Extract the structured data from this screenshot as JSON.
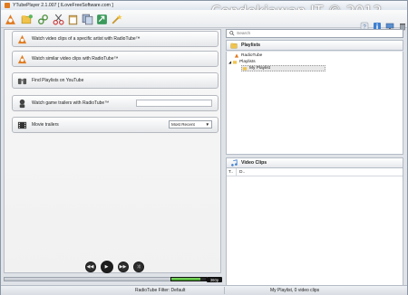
{
  "window": {
    "title": "YTubePlayer 2.1.007 [ ILoveFreeSoftware.com ]",
    "watermark": "Cendekiawan IT © 2012"
  },
  "toolbar": {
    "buttons": [
      "radiotube-icon",
      "folder-add-icon",
      "link-icon",
      "scissors-icon",
      "clipboard-icon",
      "copy-icon",
      "share-icon",
      "wand-icon"
    ],
    "right_icons": [
      "help-icon",
      "info-icon",
      "display-icon",
      "trash-icon"
    ]
  },
  "actions": {
    "artist_label": "Watch video clips of a specific artist with RadioTube™",
    "similar_label": "Watch similar video clips with RadioTube™",
    "playlists_label": "Find Playlists on YouTube",
    "game_label": "Watch game trailers with RadioTube™",
    "game_input_value": "",
    "movie_label": "Movie trailers",
    "movie_select_value": "Most Recent"
  },
  "player": {
    "progress_fraction": 0,
    "volume_fraction": 0.85,
    "volume_badge": "360p"
  },
  "search": {
    "placeholder": "Search"
  },
  "playlists": {
    "header": "Playlists",
    "items": [
      "RadioTube",
      "Playlists",
      "My Playlist"
    ]
  },
  "clips": {
    "header": "Video Clips",
    "columns": [
      "T..",
      "D.."
    ]
  },
  "status": {
    "left": "RadioTube Filter: Default",
    "right": "My Playlist, 0 video clips"
  },
  "colors": {
    "accent_orange": "#e07a1f",
    "volume_green": "#3ea125"
  }
}
